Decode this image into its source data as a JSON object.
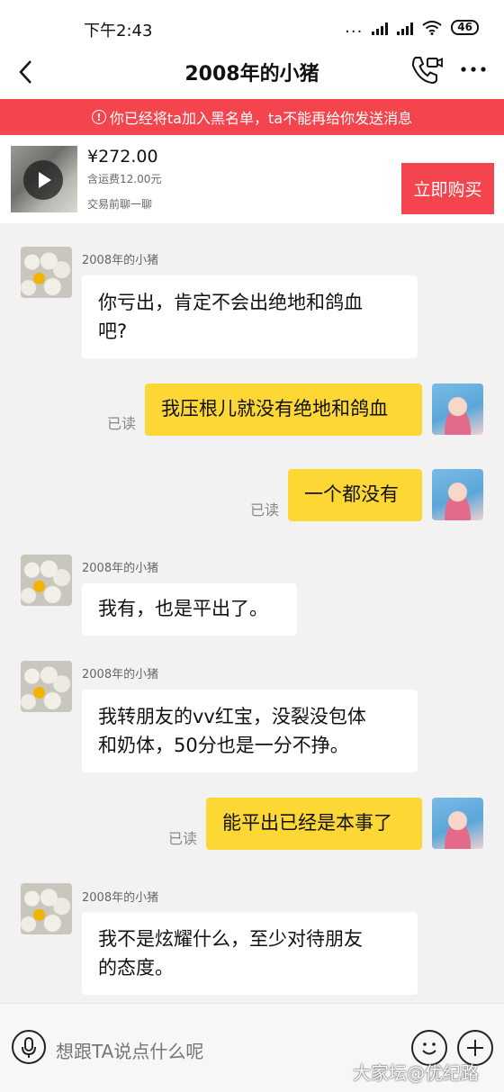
{
  "status_bar": {
    "time": "下午2:43",
    "dots": "...",
    "battery": "46",
    "icons": [
      "signal-icon",
      "signal-icon",
      "wifi-icon",
      "battery-icon"
    ]
  },
  "header": {
    "title": "2008年的小猪",
    "icons": [
      "back-arrow-icon",
      "phone-video-icon",
      "more-dots-icon"
    ]
  },
  "banner": {
    "icon": "!",
    "text": "你已经将ta加入黑名单，ta不能再给你发送消息"
  },
  "product": {
    "price": "¥272.00",
    "shipping": "含运费12.00元",
    "note": "交易前聊一聊",
    "buy_label": "立即购买",
    "accent": "#f4454e"
  },
  "messages": [
    {
      "side": "left",
      "sender": "2008年的小猪",
      "lines": [
        "你亏出，肯定不会出绝地和鸽血",
        "吧?"
      ]
    },
    {
      "side": "right",
      "text": "我压根儿就没有绝地和鸽血",
      "read": "已读"
    },
    {
      "side": "right",
      "text": "一个都没有",
      "read": "已读"
    },
    {
      "side": "left",
      "sender": "2008年的小猪",
      "lines": [
        "我有，也是平出了。"
      ]
    },
    {
      "side": "left",
      "sender": "2008年的小猪",
      "lines": [
        "我转朋友的vv红宝，没裂没包体",
        "和奶体，50分也是一分不挣。"
      ]
    },
    {
      "side": "right",
      "text": "能平出已经是本事了",
      "read": "已读"
    },
    {
      "side": "left",
      "sender": "2008年的小猪",
      "lines": [
        "我不是炫耀什么，至少对待朋友",
        "的态度。"
      ]
    }
  ],
  "input": {
    "placeholder": "想跟TA说点什么呢"
  },
  "watermark": "大家坛@优纪路",
  "colors": {
    "bubble_right": "#fdd835",
    "bubble_left": "#ffffff",
    "background": "#f2f2f2"
  }
}
